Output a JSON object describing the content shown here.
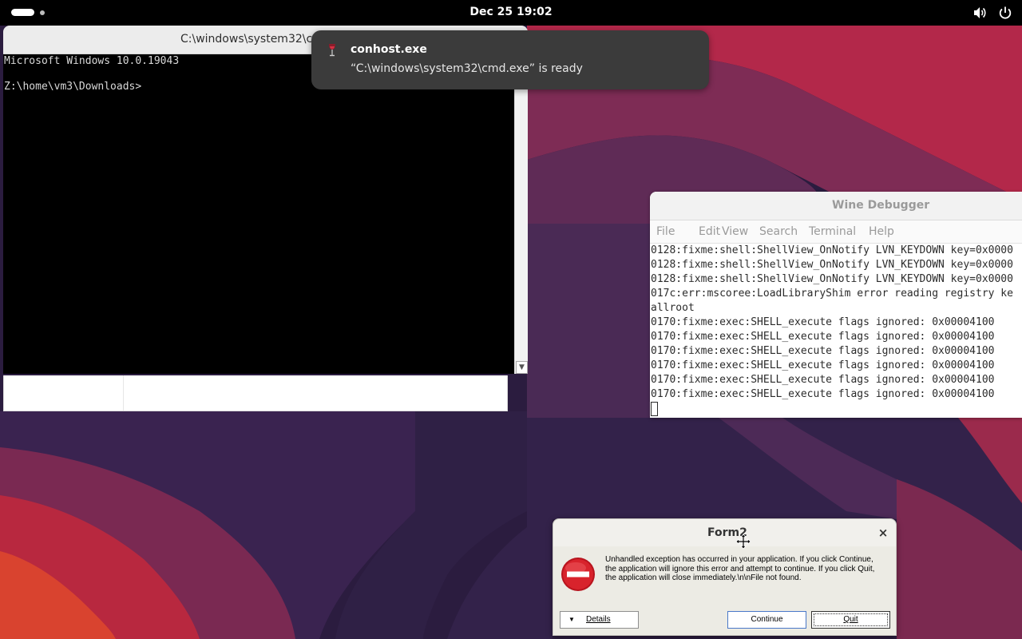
{
  "topbar": {
    "clock": "Dec 25  19:02",
    "icons": [
      "activities-icon",
      "volume-icon",
      "power-icon"
    ]
  },
  "cmd_window": {
    "title": "C:\\windows\\system32\\cmd.exe",
    "lines": [
      "Microsoft Windows 10.0.19043",
      "",
      "Z:\\home\\vm3\\Downloads>"
    ]
  },
  "notification": {
    "app": "conhost.exe",
    "body": "“C:\\windows\\system32\\cmd.exe” is ready",
    "icon": "wine-glass-icon"
  },
  "debugger": {
    "title": "Wine Debugger",
    "menu": [
      "File",
      "Edit",
      "View",
      "Search",
      "Terminal",
      "Help"
    ],
    "lines": [
      "0128:fixme:shell:ShellView_OnNotify LVN_KEYDOWN key=0x0000",
      "0128:fixme:shell:ShellView_OnNotify LVN_KEYDOWN key=0x0000",
      "0128:fixme:shell:ShellView_OnNotify LVN_KEYDOWN key=0x0000",
      "017c:err:mscoree:LoadLibraryShim error reading registry ke",
      "allroot",
      "0170:fixme:exec:SHELL_execute flags ignored: 0x00004100",
      "0170:fixme:exec:SHELL_execute flags ignored: 0x00004100",
      "0170:fixme:exec:SHELL_execute flags ignored: 0x00004100",
      "0170:fixme:exec:SHELL_execute flags ignored: 0x00004100",
      "0170:fixme:exec:SHELL_execute flags ignored: 0x00004100",
      "0170:fixme:exec:SHELL_execute flags ignored: 0x00004100"
    ]
  },
  "form_dialog": {
    "title": "Form2",
    "close_label": "×",
    "message": "Unhandled exception has occurred in your application. If you click Continue, the application will ignore this error and attempt to continue. If you click Quit, the application will close immediately.\\n\\nFile not found.",
    "details_label": "Details",
    "continue_label": "Continue",
    "quit_label": "Quit"
  },
  "colors": {
    "topbar": "#000000",
    "terminal_bg": "#000000",
    "notification_bg": "#3b3b3b",
    "error_red": "#d2202a",
    "wallpaper_dark": "#2a1b3d",
    "wallpaper_red": "#c0263d"
  }
}
